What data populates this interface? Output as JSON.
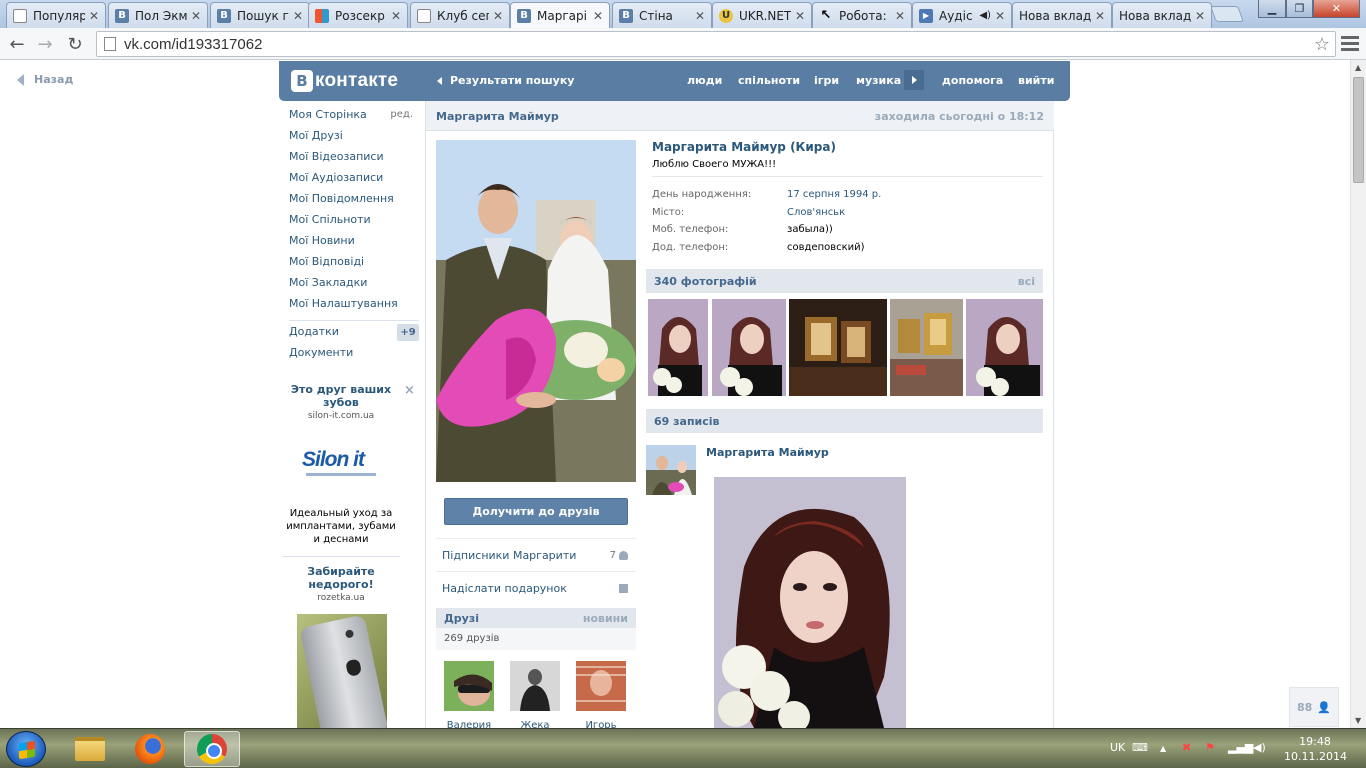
{
  "browser": {
    "tabs": [
      {
        "title": "Популяр",
        "favicon": "page-icon"
      },
      {
        "title": "Пол Экм",
        "favicon": "vk-icon"
      },
      {
        "title": "Пошук г",
        "favicon": "vk-icon"
      },
      {
        "title": "Розсекр",
        "favicon": "rozsekr-icon"
      },
      {
        "title": "Клуб сег",
        "favicon": "page-icon"
      },
      {
        "title": "Маргарі",
        "favicon": "vk-icon",
        "active": true
      },
      {
        "title": "Стіна",
        "favicon": "vk-icon"
      },
      {
        "title": "UKR.NET",
        "favicon": "ukrnet-icon"
      },
      {
        "title": "Робота:",
        "favicon": "cursor-icon"
      },
      {
        "title": "Аудіс",
        "favicon": "audio-icon"
      },
      {
        "title": "Нова вклад",
        "favicon": "none"
      },
      {
        "title": "Нова вклад",
        "favicon": "none"
      }
    ],
    "url": "vk.com/id193317062"
  },
  "page": {
    "back_label": "Назад",
    "logo_text": "контакте",
    "logo_letter": "В",
    "search_back": "Результати пошуку",
    "nav": [
      "люди",
      "спільноти",
      "ігри",
      "музика",
      "допомога",
      "вийти"
    ],
    "menu": [
      "Моя Сторінка",
      "Мої Друзі",
      "Мої Відеозаписи",
      "Мої Аудіозаписи",
      "Мої Повідомлення",
      "Мої Спільноти",
      "Мої Новини",
      "Мої Відповіді",
      "Мої Закладки",
      "Мої Налаштування"
    ],
    "menu_edit": "ред.",
    "menu_extra": [
      "Додатки",
      "Документи"
    ],
    "apps_badge": "+9",
    "ad1": {
      "title": "Это друг ваших зубов",
      "domain": "silon-it.com.ua",
      "brand": "Silon it",
      "text": "Идеальный уход за имплантами, зубами и деснами"
    },
    "ad2": {
      "title": "Забирайте недорого!",
      "domain": "rozetka.ua"
    },
    "header_name": "Маргарита Маймур",
    "header_online": "заходила сьогодні о 18:12",
    "full_name": "Маргарита Маймур (Кира)",
    "status": "Люблю Своего МУЖА!!!",
    "info": [
      {
        "k": "День народження:",
        "v": "17 серпня 1994 р.",
        "link": true
      },
      {
        "k": "Місто:",
        "v": "Слов'янськ",
        "link": true
      },
      {
        "k": "Моб. телефон:",
        "v": "забыла))",
        "link": false
      },
      {
        "k": "Дод. телефон:",
        "v": "совдеповский)",
        "link": false
      }
    ],
    "add_friend": "Долучити до друзів",
    "followers_label": "Підписники Маргарити",
    "followers_count": "7",
    "gift_label": "Надіслати подарунок",
    "friends_title": "Друзі",
    "friends_new": "новини",
    "friends_count": "269 друзів",
    "friends": [
      "Валерия",
      "Жека",
      "Игорь"
    ],
    "photos_title": "340 фотографій",
    "photos_all": "всі",
    "posts_title": "69 записів",
    "post_author": "Маргарита Маймур",
    "online_friends": "88"
  },
  "taskbar": {
    "lang": "UK",
    "time": "19:48",
    "date": "10.11.2014"
  },
  "colors": {
    "vk_blue": "#597da3",
    "link": "#2b587a",
    "header_bg": "#e1e7ed"
  }
}
